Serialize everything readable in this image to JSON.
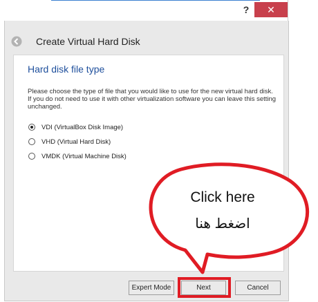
{
  "titlebar": {
    "help": "?",
    "close": "✕"
  },
  "header": {
    "title": "Create Virtual Hard Disk",
    "back_icon": "back-arrow-icon"
  },
  "section": {
    "title": "Hard disk file type"
  },
  "description": "Please choose the type of file that you would like to use for the new virtual hard disk. If you do not need to use it with other virtualization software you can leave this setting unchanged.",
  "options": [
    {
      "label": "VDI (VirtualBox Disk Image)",
      "checked": true
    },
    {
      "label": "VHD (Virtual Hard Disk)",
      "checked": false
    },
    {
      "label": "VMDK (Virtual Machine Disk)",
      "checked": false
    }
  ],
  "buttons": {
    "expert": "Expert Mode",
    "next": "Next",
    "cancel": "Cancel"
  },
  "annotation": {
    "line1": "Click here",
    "line2": "اضغط هنا",
    "color": "#e01c24"
  }
}
